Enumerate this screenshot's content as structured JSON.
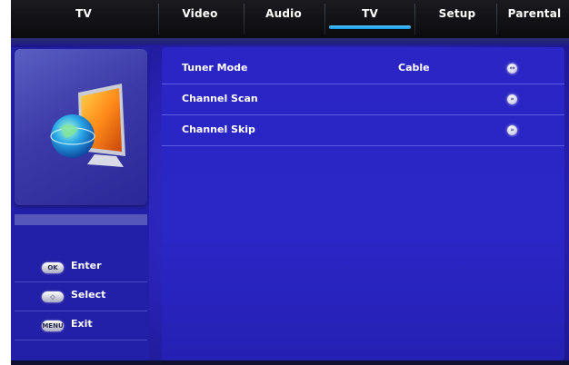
{
  "menu": {
    "section_title": "TV",
    "tabs": [
      {
        "label": "Video"
      },
      {
        "label": "Audio"
      },
      {
        "label": "TV"
      },
      {
        "label": "Setup"
      },
      {
        "label": "Parental"
      }
    ],
    "active_tab": "TV"
  },
  "main": {
    "rows": [
      {
        "label": "Tuner Mode",
        "value": "Cable",
        "icon": "left-right-arrows-icon"
      },
      {
        "label": "Channel Scan",
        "value": "",
        "icon": "enter-arrow-icon"
      },
      {
        "label": "Channel Skip",
        "value": "",
        "icon": "enter-arrow-icon"
      }
    ]
  },
  "legend": {
    "items": [
      {
        "key": "OK",
        "label": "Enter"
      },
      {
        "key": "◇",
        "label": "Select"
      },
      {
        "key": "MENU",
        "label": "Exit"
      }
    ]
  },
  "colors": {
    "accent": "#1796e8",
    "background": "#2a23b8",
    "topbar": "#0b0b0e"
  }
}
